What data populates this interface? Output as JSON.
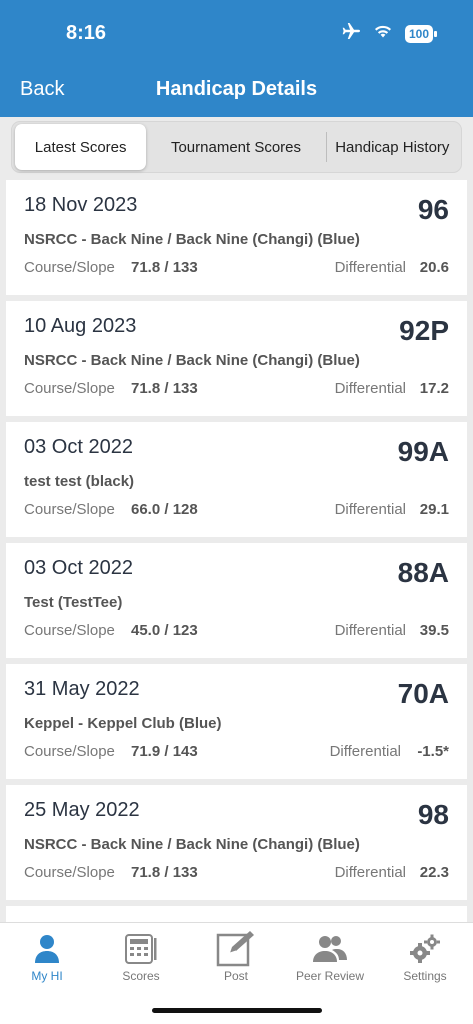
{
  "status_bar": {
    "time": "8:16",
    "battery": "100"
  },
  "nav": {
    "back_label": "Back",
    "title": "Handicap Details"
  },
  "segments": [
    {
      "label": "Latest Scores",
      "active": true
    },
    {
      "label": "Tournament Scores",
      "active": false
    },
    {
      "label": "Handicap History",
      "active": false
    }
  ],
  "labels": {
    "course_slope": "Course/Slope",
    "differential": "Differential"
  },
  "scores": [
    {
      "date": "18 Nov 2023",
      "score": "96",
      "course": "NSRCC - Back Nine / Back Nine (Changi) (Blue)",
      "course_slope": "71.8 / 133",
      "differential": "20.6"
    },
    {
      "date": "10 Aug 2023",
      "score": "92P",
      "course": "NSRCC - Back Nine / Back Nine (Changi) (Blue)",
      "course_slope": "71.8 / 133",
      "differential": "17.2"
    },
    {
      "date": "03 Oct 2022",
      "score": "99A",
      "course": "test test (black)",
      "course_slope": "66.0 / 128",
      "differential": "29.1"
    },
    {
      "date": "03 Oct 2022",
      "score": "88A",
      "course": "Test (TestTee)",
      "course_slope": "45.0 / 123",
      "differential": "39.5"
    },
    {
      "date": "31 May 2022",
      "score": "70A",
      "course": "Keppel - Keppel Club (Blue)",
      "course_slope": "71.9 / 143",
      "differential": "-1.5*"
    },
    {
      "date": "25 May 2022",
      "score": "98",
      "course": "NSRCC - Back Nine / Back Nine (Changi) (Blue)",
      "course_slope": "71.8 / 133",
      "differential": "22.3"
    }
  ],
  "tabbar": [
    {
      "label": "My HI",
      "icon": "person-icon",
      "active": true
    },
    {
      "label": "Scores",
      "icon": "scorecard-icon",
      "active": false
    },
    {
      "label": "Post",
      "icon": "edit-icon",
      "active": false
    },
    {
      "label": "Peer Review",
      "icon": "group-icon",
      "active": false
    },
    {
      "label": "Settings",
      "icon": "gears-icon",
      "active": false
    }
  ],
  "colors": {
    "header": "#2f86c9",
    "accent": "#2f86c9",
    "text_dark": "#2b3442"
  }
}
